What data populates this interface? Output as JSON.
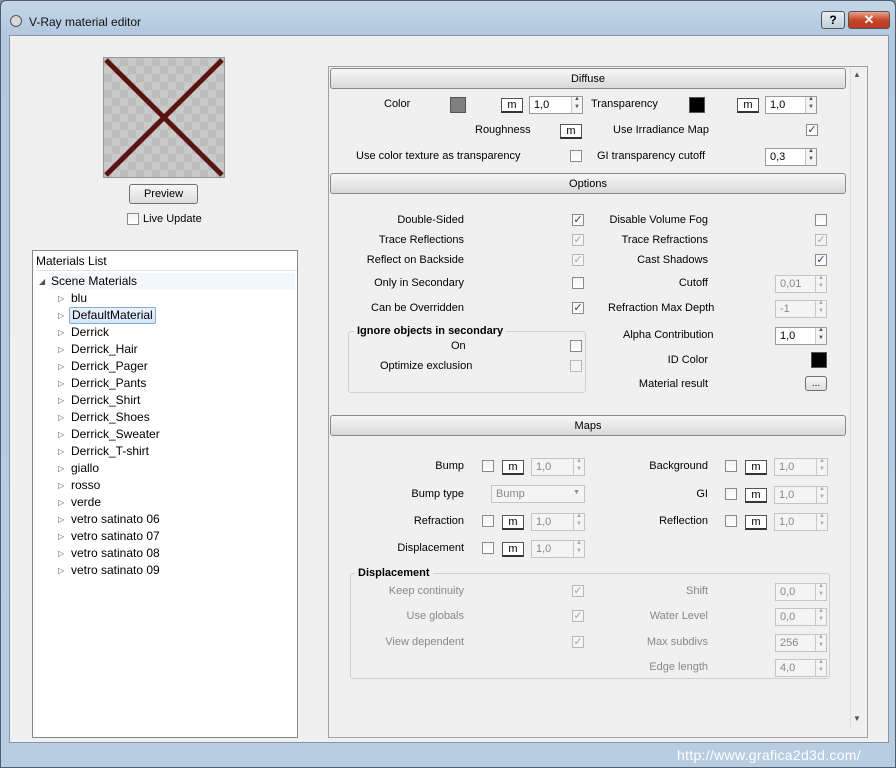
{
  "window": {
    "title": "V-Ray material editor",
    "help_label": "?",
    "close_label": "✕"
  },
  "preview": {
    "button_label": "Preview",
    "live_update_label": "Live Update",
    "live_update_checked": false
  },
  "materials": {
    "header": "Materials List",
    "root_label": "Scene Materials",
    "items": [
      "blu",
      "DefaultMaterial",
      "Derrick",
      "Derrick_Hair",
      "Derrick_Pager",
      "Derrick_Pants",
      "Derrick_Shirt",
      "Derrick_Shoes",
      "Derrick_Sweater",
      "Derrick_T-shirt",
      "giallo",
      "rosso",
      "verde",
      "vetro satinato 06",
      "vetro satinato 07",
      "vetro satinato 08",
      "vetro satinato 09"
    ],
    "selected": "DefaultMaterial"
  },
  "diffuse": {
    "header": "Diffuse",
    "color_label": "Color",
    "color_swatch": "#808080",
    "color_value": "1,0",
    "transparency_label": "Transparency",
    "transparency_swatch": "#000000",
    "transparency_value": "1,0",
    "roughness_label": "Roughness",
    "use_irradiance_label": "Use Irradiance Map",
    "use_irradiance_checked": true,
    "use_color_texture_label": "Use color texture as transparency",
    "use_color_texture_checked": false,
    "gi_cutoff_label": "GI transparency cutoff",
    "gi_cutoff_value": "0,3",
    "m_label": "m"
  },
  "options": {
    "header": "Options",
    "double_sided_label": "Double-Sided",
    "trace_reflections_label": "Trace Reflections",
    "reflect_backside_label": "Reflect on Backside",
    "only_secondary_label": "Only in Secondary",
    "overridden_label": "Can be Overridden",
    "disable_fog_label": "Disable Volume Fog",
    "trace_refractions_label": "Trace Refractions",
    "cast_shadows_label": "Cast Shadows",
    "cutoff_label": "Cutoff",
    "cutoff_value": "0,01",
    "refraction_depth_label": "Refraction Max Depth",
    "refraction_depth_value": "-1",
    "alpha_label": "Alpha Contribution",
    "alpha_value": "1,0",
    "id_color_label": "ID Color",
    "id_color_swatch": "#000000",
    "material_result_label": "Material result",
    "material_result_button": "...",
    "ignore_group_title": "Ignore objects in secondary",
    "on_label": "On",
    "optimize_label": "Optimize exclusion"
  },
  "maps": {
    "header": "Maps",
    "bump_label": "Bump",
    "bump_value": "1,0",
    "bump_type_label": "Bump type",
    "bump_type_value": "Bump",
    "refraction_label": "Refraction",
    "refraction_value": "1,0",
    "displacement_label": "Displacement",
    "displacement_value": "1,0",
    "background_label": "Background",
    "background_value": "1,0",
    "gi_label": "GI",
    "gi_value": "1,0",
    "reflection_label": "Reflection",
    "reflection_value": "1,0",
    "m_label": "m"
  },
  "displacement": {
    "group_title": "Displacement",
    "keep_continuity_label": "Keep continuity",
    "use_globals_label": "Use globals",
    "view_dependent_label": "View dependent",
    "shift_label": "Shift",
    "shift_value": "0,0",
    "water_level_label": "Water Level",
    "water_level_value": "0,0",
    "max_subdivs_label": "Max subdivs",
    "max_subdivs_value": "256",
    "edge_length_label": "Edge length",
    "edge_length_value": "4,0"
  },
  "watermark": "http://www.grafica2d3d.com/"
}
